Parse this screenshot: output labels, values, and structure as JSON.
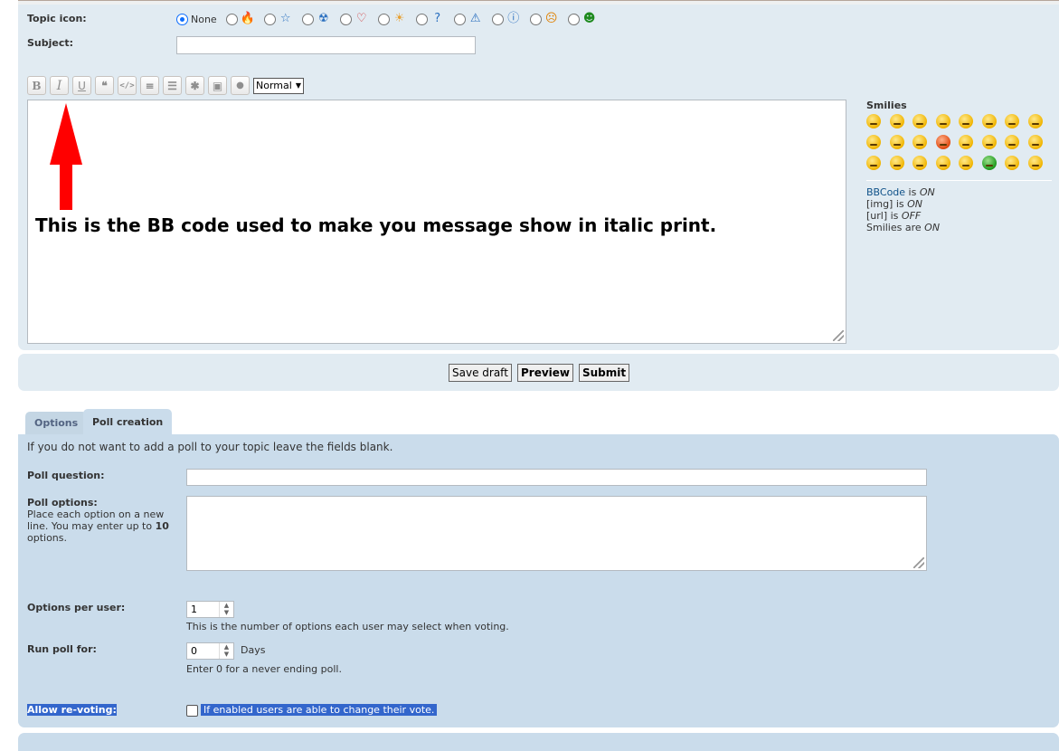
{
  "post": {
    "topic_icon_label": "Topic icon:",
    "topic_icon_none": "None",
    "topic_icons": [
      "fire-icon",
      "star-icon",
      "radioactive-icon",
      "heart-icon",
      "sun-icon",
      "question-icon",
      "warning-icon",
      "info-icon",
      "mad-icon",
      "grin-icon"
    ],
    "topic_icon_glyphs": [
      "🔥",
      "☆",
      "☢",
      "♡",
      "☀",
      "?",
      "⚠",
      "ⓘ",
      "☹",
      "☻"
    ],
    "topic_icon_colors": [
      "#e8a030",
      "#2a6fbf",
      "#2a6fbf",
      "#d03030",
      "#e8a030",
      "#2a6fbf",
      "#2a6fbf",
      "#2a6fbf",
      "#e08000",
      "#1e8a1e"
    ],
    "subject_label": "Subject:",
    "subject_value": ""
  },
  "toolbar": {
    "bold_label": "B",
    "italic_label": "I",
    "underline_label": "U",
    "quote_label": "❝",
    "code_label": "</>",
    "list_label": "≡",
    "list_ordered_label": "☰",
    "list_item_label": "✱",
    "image_label": "▣",
    "color_label": "●",
    "font_size_value": "Normal"
  },
  "editor": {
    "annotation": "This is the BB code used to make you message show in italic print."
  },
  "smilies": {
    "title": "Smilies",
    "count": 24,
    "variants": [
      "y",
      "y",
      "y",
      "y",
      "y",
      "y",
      "y",
      "y",
      "y",
      "y",
      "y",
      "r",
      "y",
      "y",
      "y",
      "y",
      "y",
      "y",
      "y",
      "y",
      "y",
      "g",
      "y",
      "y"
    ]
  },
  "bb_status": {
    "bbcode_link": "BBCode",
    "bbcode_text": " is ",
    "bbcode_state": "ON",
    "img_text": "[img] is ",
    "img_state": "ON",
    "url_text": "[url] is ",
    "url_state": "OFF",
    "smilies_text": "Smilies are ",
    "smilies_state": "ON"
  },
  "buttons": {
    "save_draft": "Save draft",
    "preview": "Preview",
    "submit": "Submit"
  },
  "tabs": {
    "options": "Options",
    "poll_creation": "Poll creation"
  },
  "poll": {
    "intro": "If you do not want to add a poll to your topic leave the fields blank.",
    "question_label": "Poll question:",
    "question_value": "",
    "options_label": "Poll options:",
    "options_help_1": "Place each option on a new",
    "options_help_2": "line. You may enter up to ",
    "options_help_max": "10",
    "options_help_3": "options.",
    "options_value": "",
    "per_user_label": "Options per user:",
    "per_user_value": "1",
    "per_user_help": "This is the number of options each user may select when voting.",
    "run_for_label": "Run poll for:",
    "run_for_value": "0",
    "run_for_unit": "Days",
    "run_for_help": "Enter 0 for a never ending poll.",
    "revote_label": "Allow re-voting:",
    "revote_help": "If enabled users are able to change their vote."
  },
  "colors": {
    "panel_bg": "#e1ebf2",
    "poll_bg": "#cadceb",
    "link": "#105289",
    "annotation_arrow": "#ff0000",
    "selection": "#3366cc"
  }
}
